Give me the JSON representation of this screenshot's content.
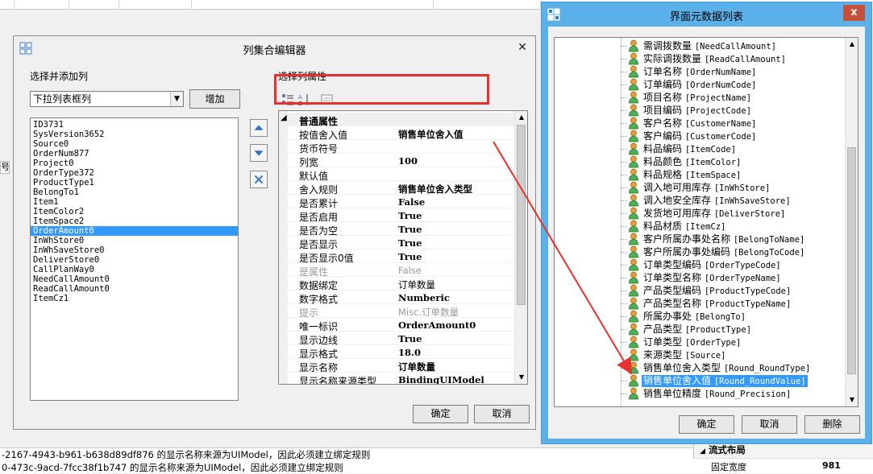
{
  "background": {
    "left_label": "号",
    "log_lines": [
      "-2167-4943-b961-b638d89df876 的显示名称来源为UIModel，因此必须建立绑定规则",
      "0-473c-9acd-7fcc38f1b747 的显示名称来源为UIModel，因此必须建立绑定规则"
    ],
    "flow_header": "流式布局",
    "flow_row": {
      "key": "固定宽度",
      "value": "981"
    }
  },
  "editor": {
    "title": "列集合编辑器",
    "left_label": "选择并添加列",
    "right_label": "选择列属性",
    "column_type": "下拉列表框列",
    "add_label": "增加",
    "columns": [
      "ID3731",
      "SysVersion3652",
      "Source0",
      "OrderNum877",
      "Project0",
      "OrderType372",
      "ProductType1",
      "BelongTo1",
      "Item1",
      "ItemColor2",
      "ItemSpace2",
      "OrderAmount0",
      "InWhStore0",
      "InWhSaveStore0",
      "DeliverStore0",
      "CallPlanWay0",
      "NeedCallAmount0",
      "ReadCallAmount0",
      "ItemCz1"
    ],
    "selected_index": 11,
    "category": "普通属性",
    "properties": [
      {
        "k": "按值舍入值",
        "v": "销售单位舍入值",
        "bold": true
      },
      {
        "k": "货币符号",
        "v": ""
      },
      {
        "k": "列宽",
        "v": "100",
        "bold": true
      },
      {
        "k": "默认值",
        "v": ""
      },
      {
        "k": "舍入规则",
        "v": "销售单位舍入类型",
        "bold": true
      },
      {
        "k": "是否累计",
        "v": "False",
        "bold": true
      },
      {
        "k": "是否启用",
        "v": "True",
        "bold": true
      },
      {
        "k": "是否为空",
        "v": "True",
        "bold": true
      },
      {
        "k": "是否显示",
        "v": "True",
        "bold": true
      },
      {
        "k": "是否显示0值",
        "v": "True",
        "bold": true
      },
      {
        "k": "是属性",
        "v": "False",
        "dim": true
      },
      {
        "k": "数据绑定",
        "v": "订单数量"
      },
      {
        "k": "数字格式",
        "v": "Numberic",
        "bold": true
      },
      {
        "k": "提示",
        "v": "Misc.订单数量",
        "dim": true
      },
      {
        "k": "唯一标识",
        "v": "OrderAmount0",
        "bold": true
      },
      {
        "k": "显示边线",
        "v": "True",
        "bold": true
      },
      {
        "k": "显示格式",
        "v": "18.0",
        "bold": true
      },
      {
        "k": "显示名称",
        "v": "订单数量",
        "bold": true
      },
      {
        "k": "显示名称来源类型",
        "v": "BindingUIModel",
        "bold": true
      }
    ],
    "ok_label": "确定",
    "cancel_label": "取消"
  },
  "metadata": {
    "title": "界面元数据列表",
    "close_label": "x",
    "nodes": [
      {
        "name": "需调拨数量",
        "field": "[NeedCallAmount]"
      },
      {
        "name": "实际调拨数量",
        "field": "[ReadCallAmount]"
      },
      {
        "name": "订单名称",
        "field": "[OrderNumName]"
      },
      {
        "name": "订单编码",
        "field": "[OrderNumCode]"
      },
      {
        "name": "项目名称",
        "field": "[ProjectName]"
      },
      {
        "name": "项目编码",
        "field": "[ProjectCode]"
      },
      {
        "name": "客户名称",
        "field": "[CustomerName]"
      },
      {
        "name": "客户编码",
        "field": "[CustomerCode]"
      },
      {
        "name": "料品编码",
        "field": "[ItemCode]"
      },
      {
        "name": "料品颜色",
        "field": "[ItemColor]"
      },
      {
        "name": "料品规格",
        "field": "[ItemSpace]"
      },
      {
        "name": "调入地可用库存",
        "field": "[InWhStore]"
      },
      {
        "name": "调入地安全库存",
        "field": "[InWhSaveStore]"
      },
      {
        "name": "发货地可用库存",
        "field": "[DeliverStore]"
      },
      {
        "name": "料品材质",
        "field": "[ItemCz]"
      },
      {
        "name": "客户所属办事处名称",
        "field": "[BelongToName]"
      },
      {
        "name": "客户所属办事处编码",
        "field": "[BelongToCode]"
      },
      {
        "name": "订单类型编码",
        "field": "[OrderTypeCode]"
      },
      {
        "name": "订单类型名称",
        "field": "[OrderTypeName]"
      },
      {
        "name": "产品类型编码",
        "field": "[ProductTypeCode]"
      },
      {
        "name": "产品类型名称",
        "field": "[ProductTypeName]"
      },
      {
        "name": "所属办事处",
        "field": "[BelongTo]"
      },
      {
        "name": "产品类型",
        "field": "[ProductType]"
      },
      {
        "name": "订单类型",
        "field": "[OrderType]"
      },
      {
        "name": "来源类型",
        "field": "[Source]"
      },
      {
        "name": "销售单位舍入类型",
        "field": "[Round_RoundType]"
      },
      {
        "name": "销售单位舍入值",
        "field": "[Round_RoundValue]"
      },
      {
        "name": "销售单位精度",
        "field": "[Round_Precision]"
      }
    ],
    "selected_index": 26,
    "ok_label": "确定",
    "cancel_label": "取消",
    "delete_label": "删除"
  },
  "colors": {
    "highlight": "#e8302e",
    "selection": "#3399ff",
    "titlebar": "#5ab1ea"
  }
}
